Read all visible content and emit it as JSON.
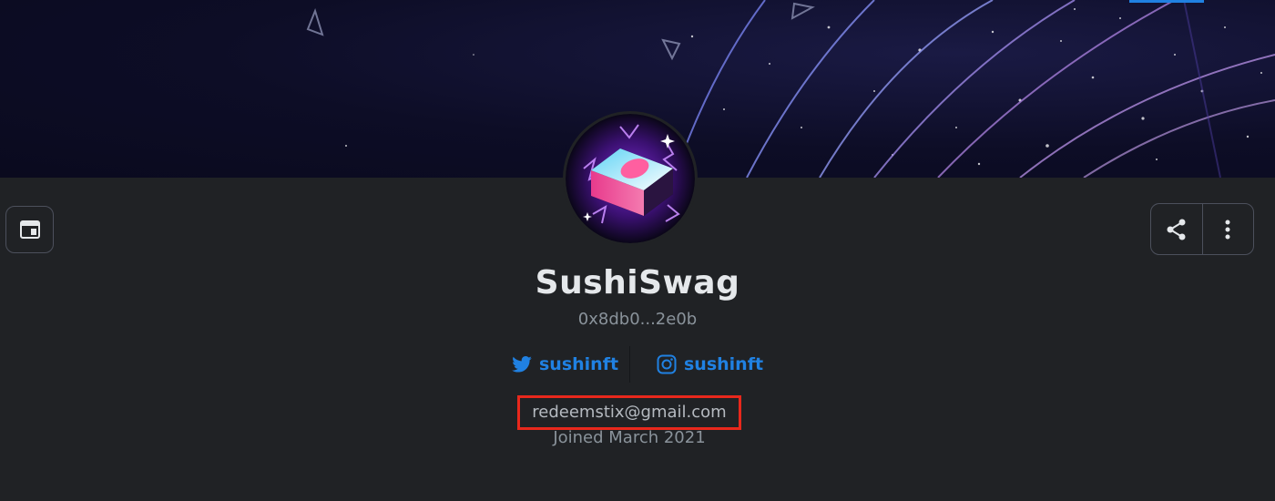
{
  "profile": {
    "username": "SushiSwag",
    "wallet_address": "0x8db0...2e0b",
    "email": "redeemstix@gmail.com",
    "joined": "Joined March 2021"
  },
  "socials": {
    "twitter": {
      "icon": "twitter-icon",
      "handle": "sushinft"
    },
    "instagram": {
      "icon": "instagram-icon",
      "handle": "sushinft"
    }
  },
  "controls": {
    "left_icon": "layout-toggle-icon",
    "share_icon": "share-icon",
    "more_icon": "more-vertical-icon"
  },
  "colors": {
    "background": "#202225",
    "link": "#2081e2",
    "highlight": "#e8281c",
    "banner": "#0d0d26"
  }
}
